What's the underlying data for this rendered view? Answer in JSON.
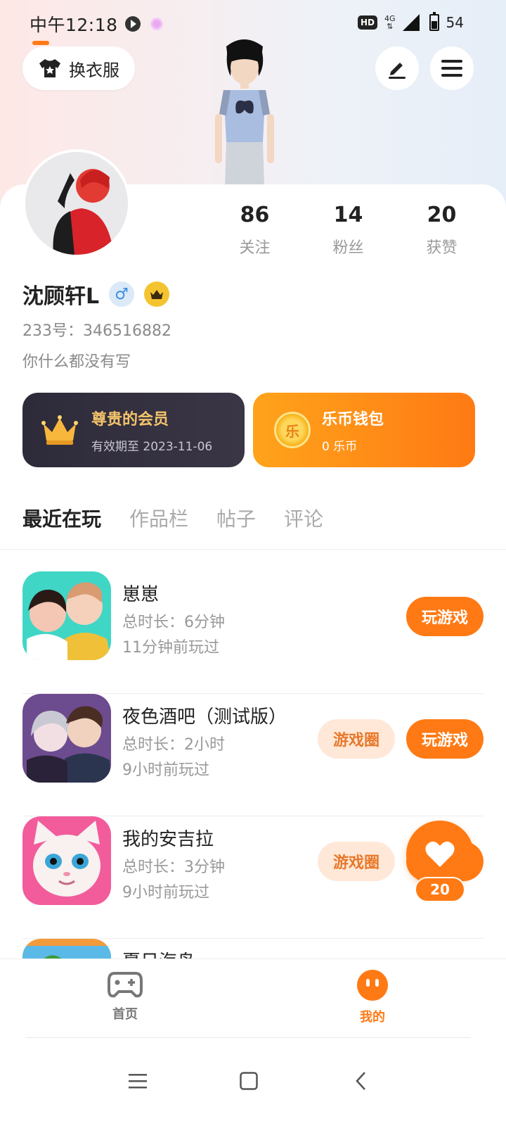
{
  "status_bar": {
    "time": "中午12:18",
    "hd": "HD",
    "network": "4G",
    "battery": "54"
  },
  "header": {
    "dress_button_label": "换衣服"
  },
  "profile": {
    "stats": [
      {
        "value": "86",
        "label": "关注"
      },
      {
        "value": "14",
        "label": "粉丝"
      },
      {
        "value": "20",
        "label": "获赞"
      }
    ],
    "username": "沈顾轩L",
    "gender_symbol": "♂",
    "account_id": "233号：346516882",
    "bio": "你什么都没有写"
  },
  "cards": {
    "vip": {
      "title": "尊贵的会员",
      "subtitle": "有效期至 2023-11-06"
    },
    "wallet": {
      "title": "乐币钱包",
      "subtitle": "0 乐币",
      "coin_glyph": "乐"
    }
  },
  "tabs": [
    {
      "label": "最近在玩",
      "active": true
    },
    {
      "label": "作品栏",
      "active": false
    },
    {
      "label": "帖子",
      "active": false
    },
    {
      "label": "评论",
      "active": false
    }
  ],
  "games": [
    {
      "name": "崽崽",
      "duration": "总时长：6分钟",
      "last_played": "11分钟前玩过",
      "has_circle": false
    },
    {
      "name": "夜色酒吧（测试版）",
      "duration": "总时长：2小时",
      "last_played": "9小时前玩过",
      "has_circle": true
    },
    {
      "name": "我的安吉拉",
      "duration": "总时长：3分钟",
      "last_played": "9小时前玩过",
      "has_circle": true
    },
    {
      "name": "夏日海岛",
      "duration": "",
      "last_played": "",
      "has_circle": false
    }
  ],
  "game_buttons": {
    "play": "玩游戏",
    "circle": "游戏圈"
  },
  "float_like": {
    "count": "20"
  },
  "bottom_nav": [
    {
      "label": "首页",
      "icon": "gamepad-icon",
      "active": false
    },
    {
      "label": "我的",
      "icon": "face-icon",
      "active": true
    }
  ],
  "colors": {
    "accent": "#ff7a14",
    "vip_card": "#2d2a3a",
    "vip_text": "#f4c46a"
  }
}
